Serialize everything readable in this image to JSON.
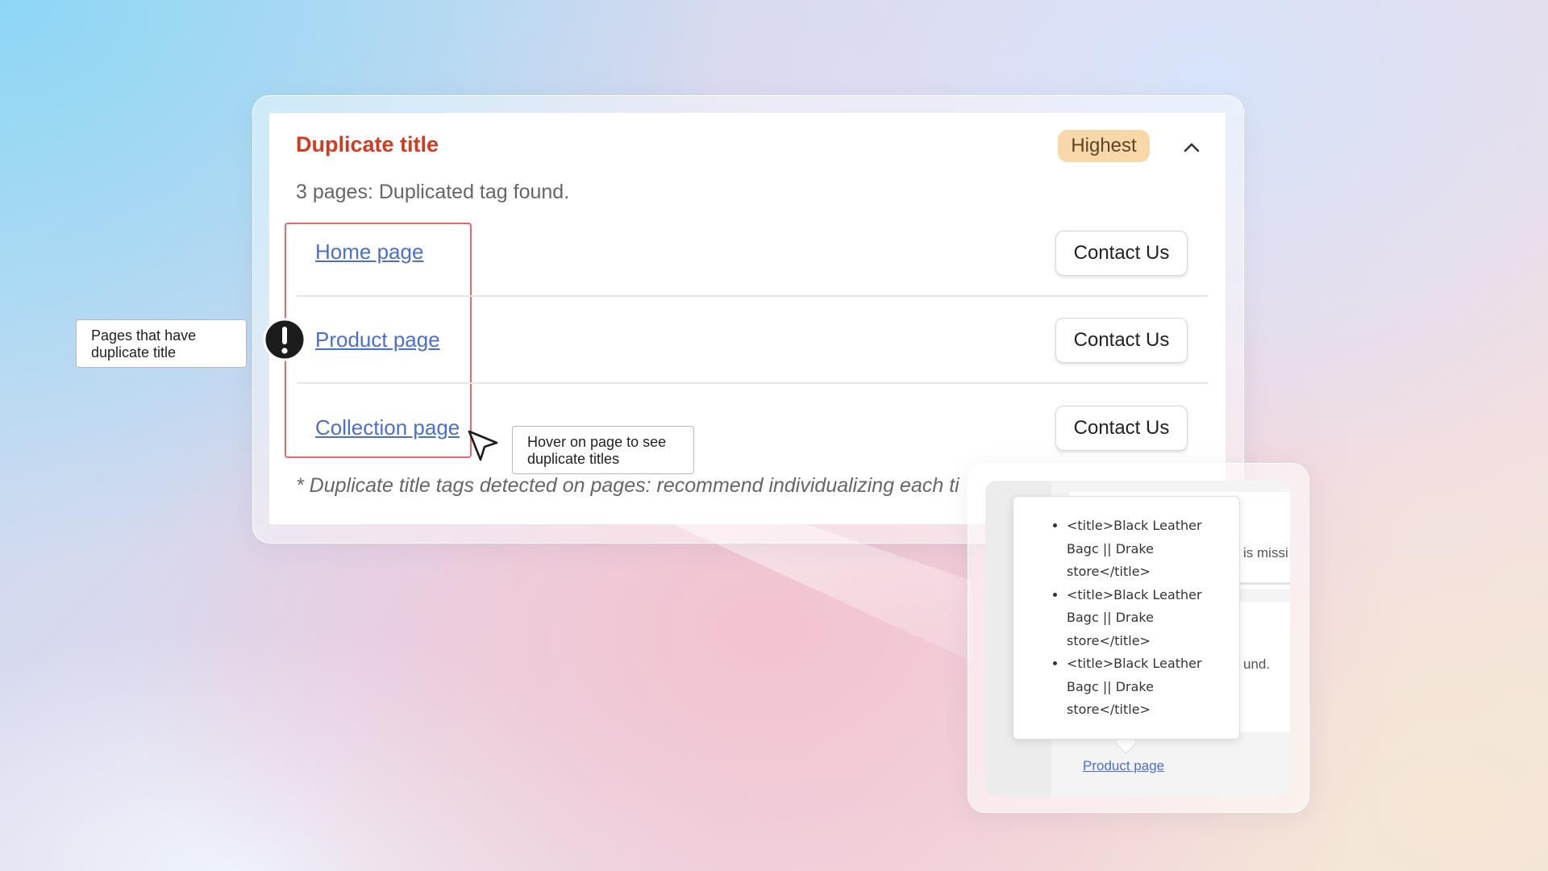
{
  "card": {
    "title": "Duplicate title",
    "priority_badge": "Highest",
    "summary": "3 pages: Duplicated tag found.",
    "rows": [
      {
        "page": "Home page",
        "action": "Contact Us"
      },
      {
        "page": "Product page",
        "action": "Contact Us"
      },
      {
        "page": "Collection page",
        "action": "Contact Us"
      }
    ],
    "footnote": "* Duplicate title tags detected on pages: recommend individualizing each ti"
  },
  "annotations": {
    "pages_callout": "Pages that have duplicate title",
    "hover_callout": "Hover on page to see duplicate titles"
  },
  "zoom": {
    "duplicate_titles": [
      "<title>Black Leather Bagc || Drake store</title>",
      "<title>Black Leather Bagc || Drake store</title>",
      "<title>Black Leather Bagc || Drake store</title>"
    ],
    "fragment_missing": "is missi",
    "fragment_found": "und.",
    "link": "Product page"
  },
  "colors": {
    "title_red": "#d23b1f",
    "badge_bg": "#f8d7a8",
    "link_blue": "#4a6fd1",
    "highlight_red": "#e8676b"
  },
  "icons": [
    "chevron-up-icon",
    "exclamation-icon",
    "mouse-cursor-icon"
  ]
}
